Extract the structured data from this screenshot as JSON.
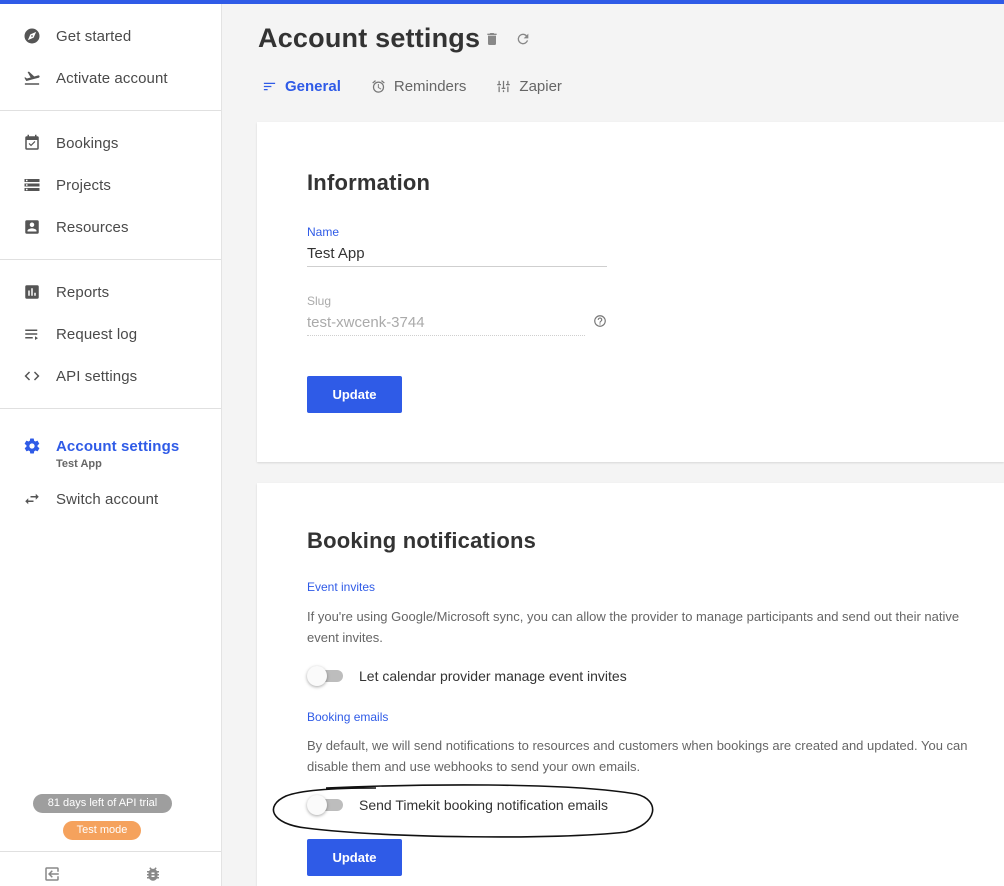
{
  "colors": {
    "accent": "#2f5be7",
    "trial_badge": "#9e9e9e",
    "mode_badge": "#f5a25d"
  },
  "sidebar": {
    "groups": [
      [
        {
          "label": "Get started",
          "icon": "compass-icon"
        },
        {
          "label": "Activate account",
          "icon": "airplane-takeoff-icon"
        }
      ],
      [
        {
          "label": "Bookings",
          "icon": "calendar-check-icon"
        },
        {
          "label": "Projects",
          "icon": "storage-icon"
        },
        {
          "label": "Resources",
          "icon": "person-box-icon"
        }
      ],
      [
        {
          "label": "Reports",
          "icon": "bar-chart-icon"
        },
        {
          "label": "Request log",
          "icon": "list-icon"
        },
        {
          "label": "API settings",
          "icon": "code-icon"
        }
      ],
      [
        {
          "label": "Account settings",
          "icon": "gear-icon",
          "sub": "Test App",
          "active": true
        },
        {
          "label": "Switch account",
          "icon": "swap-icon"
        }
      ]
    ],
    "trial_badge": "81 days left of API trial",
    "mode_badge": "Test mode",
    "footer_icons": [
      "exit-icon",
      "bug-icon"
    ]
  },
  "header": {
    "title": "Account settings",
    "tabs": [
      {
        "label": "General",
        "icon": "sort-icon",
        "active": true
      },
      {
        "label": "Reminders",
        "icon": "alarm-icon"
      },
      {
        "label": "Zapier",
        "icon": "tune-icon"
      }
    ]
  },
  "information": {
    "title": "Information",
    "name_label": "Name",
    "name_value": "Test App",
    "slug_label": "Slug",
    "slug_value": "test-xwcenk-3744",
    "update_label": "Update"
  },
  "notifications": {
    "title": "Booking notifications",
    "event_invites_label": "Event invites",
    "event_invites_desc": "If you're using Google/Microsoft sync, you can allow the provider to manage participants and send out their native event invites.",
    "event_invites_toggle": "Let calendar provider manage event invites",
    "event_invites_on": false,
    "booking_emails_label": "Booking emails",
    "booking_emails_desc": "By default, we will send notifications to resources and customers when bookings are created and updated. You can disable them and use webhooks to send your own emails.",
    "booking_emails_toggle": "Send Timekit booking notification emails",
    "booking_emails_on": false,
    "update_label": "Update"
  }
}
